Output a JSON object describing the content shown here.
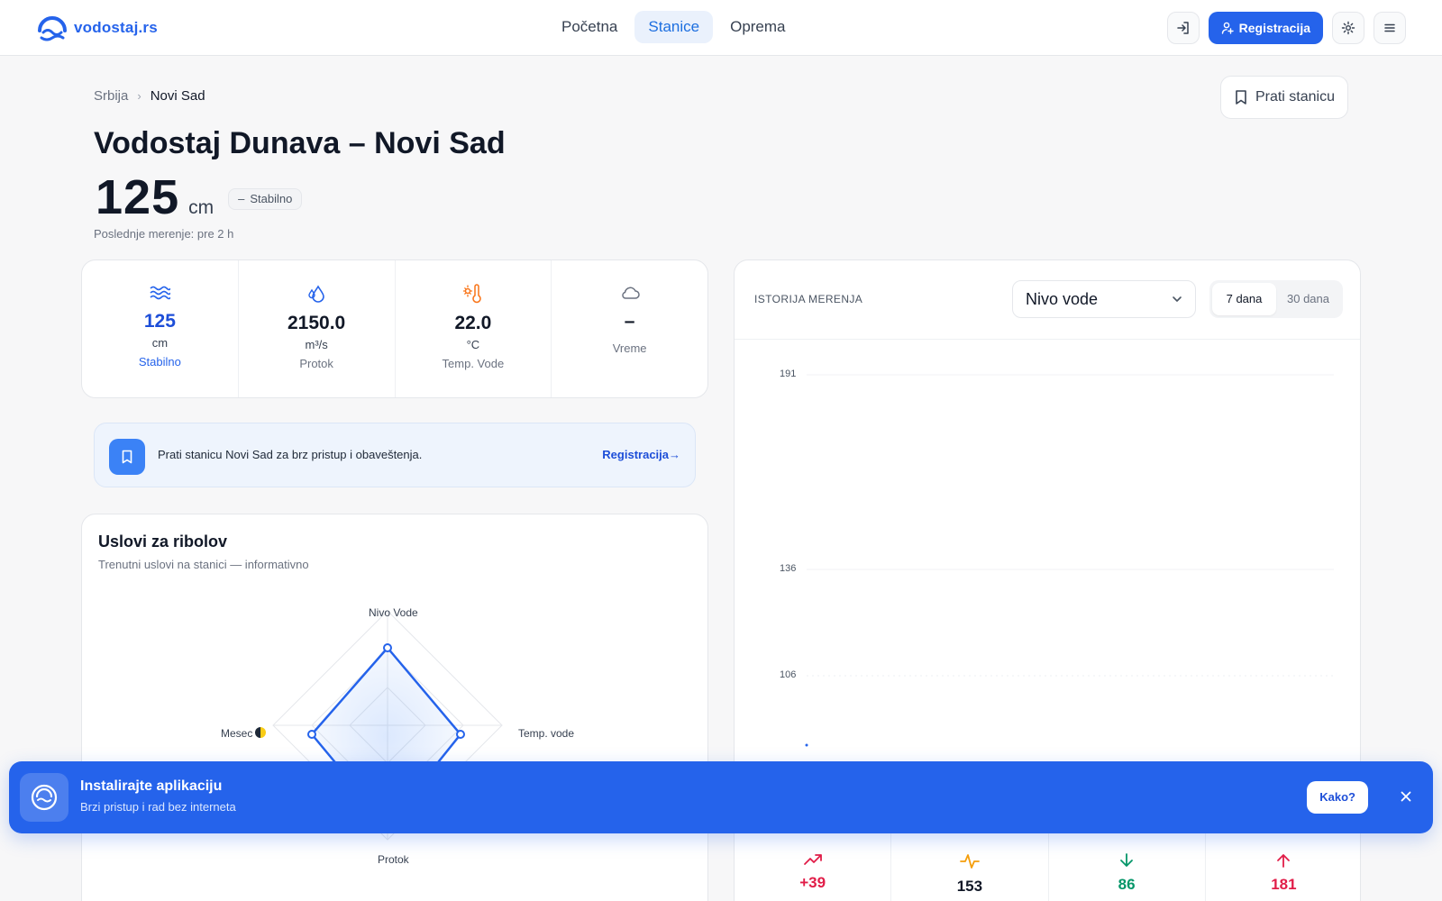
{
  "header": {
    "logo_text": "vodostaj.rs",
    "nav": [
      {
        "label": "Početna",
        "active": false
      },
      {
        "label": "Stanice",
        "active": true
      },
      {
        "label": "Oprema",
        "active": false
      }
    ],
    "register_label": "Registracija"
  },
  "breadcrumb": {
    "parent": "Srbija",
    "current": "Novi Sad"
  },
  "follow_button_label": "Prati stanicu",
  "title": "Vodostaj Dunava – Novi Sad",
  "level": {
    "value": "125",
    "unit": "cm",
    "trend": "Stabilno"
  },
  "last_measurement": "Poslednje merenje: pre 2 h",
  "stats": [
    {
      "icon": "waves-icon",
      "value": "125",
      "unit": "cm",
      "label": "Stabilno"
    },
    {
      "icon": "drop-icon",
      "value": "2150.0",
      "unit": "m³/s",
      "label": "Protok"
    },
    {
      "icon": "thermometer-icon",
      "value": "22.0",
      "unit": "°C",
      "label": "Temp. Vode"
    },
    {
      "icon": "cloud-icon",
      "value": "–",
      "unit": "",
      "label": "Vreme"
    }
  ],
  "follow_banner": {
    "text": "Prati stanicu Novi Sad za brz pristup i obaveštenja.",
    "link": "Registracija→"
  },
  "fishing": {
    "title": "Uslovi za ribolov",
    "subtitle": "Trenutni uslovi na stanici — informativno",
    "axes": [
      "Nivo Vode",
      "Temp. vode",
      "Protok",
      "Mesec"
    ]
  },
  "history": {
    "title": "ISTORIJA MERENJA",
    "select_value": "Nivo vode",
    "range_options": [
      "7 dana",
      "30 dana"
    ],
    "active_range": "7 dana",
    "y_ticks": [
      "191",
      "136",
      "106"
    ]
  },
  "summary": [
    {
      "icon": "trend-up-icon",
      "value": "+39",
      "color": "#e11d48"
    },
    {
      "icon": "pulse-icon",
      "value": "153",
      "color": "#111827"
    },
    {
      "icon": "arrow-down-icon",
      "value": "86",
      "color": "#059669"
    },
    {
      "icon": "arrow-up-icon",
      "value": "181",
      "color": "#e11d48"
    }
  ],
  "install_banner": {
    "title": "Instalirajte aplikaciju",
    "subtitle": "Brzi pristup i rad bez interneta",
    "button": "Kako?"
  },
  "colors": {
    "accent": "#2563eb",
    "accent_light": "#eef4fd",
    "danger": "#e11d48",
    "success": "#059669",
    "warning": "#f59e0b"
  }
}
